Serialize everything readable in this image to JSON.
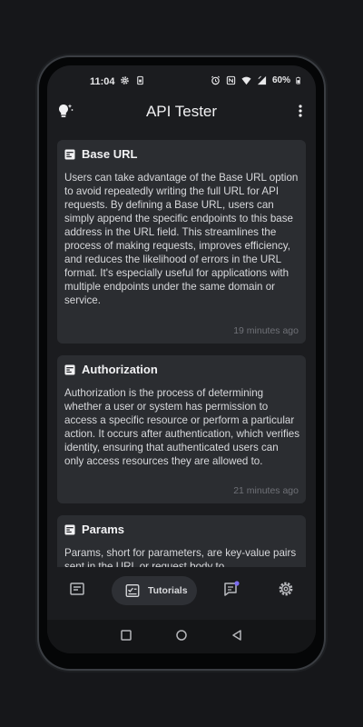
{
  "status_bar": {
    "time": "11:04",
    "battery": "60%",
    "icons": [
      "gear-icon",
      "sim-icon",
      "alarm-icon",
      "nfc-icon",
      "wifi-icon",
      "signal-icon",
      "battery-icon"
    ]
  },
  "app_bar": {
    "title": "API Tester",
    "left_icon": "lightbulb-icon",
    "right_icon": "more-vert-icon"
  },
  "cards": [
    {
      "title": "Base URL",
      "icon": "article-icon",
      "body": "Users can take advantage of the Base URL option to avoid repeatedly writing the full URL for API requests. By defining a Base URL, users can simply append the specific endpoints to this base address in the URL field. This streamlines the process of making requests, improves efficiency, and reduces the likelihood of errors in the URL format. It's especially useful for applications with multiple endpoints under the same domain or service.",
      "time": "19 minutes ago"
    },
    {
      "title": "Authorization",
      "icon": "article-icon",
      "body": "Authorization is the process of determining whether a user or system has permission to access a specific resource or perform a particular action. It occurs after authentication, which verifies identity, ensuring that authenticated users can only access resources they are allowed to.",
      "time": "21 minutes ago"
    },
    {
      "title": "Params",
      "icon": "article-icon",
      "body": "Params, short for parameters, are key-value pairs sent in the URL or request body to",
      "time": ""
    }
  ],
  "bottom_nav": {
    "items": [
      {
        "icon": "history-icon",
        "label": ""
      },
      {
        "icon": "tutorials-icon",
        "label": "Tutorials",
        "selected": true
      },
      {
        "icon": "chat-icon",
        "label": ""
      },
      {
        "icon": "settings-icon",
        "label": ""
      }
    ]
  },
  "system_nav": {
    "items": [
      "recents-button",
      "home-button",
      "back-button"
    ]
  },
  "colors": {
    "background": "#16171a",
    "screen": "#1b1c1f",
    "card": "#2b2d31",
    "pill": "#2e3035",
    "text": "#d8d9dc",
    "muted": "#6f7177",
    "chat_dot": "#7c6cf0"
  }
}
